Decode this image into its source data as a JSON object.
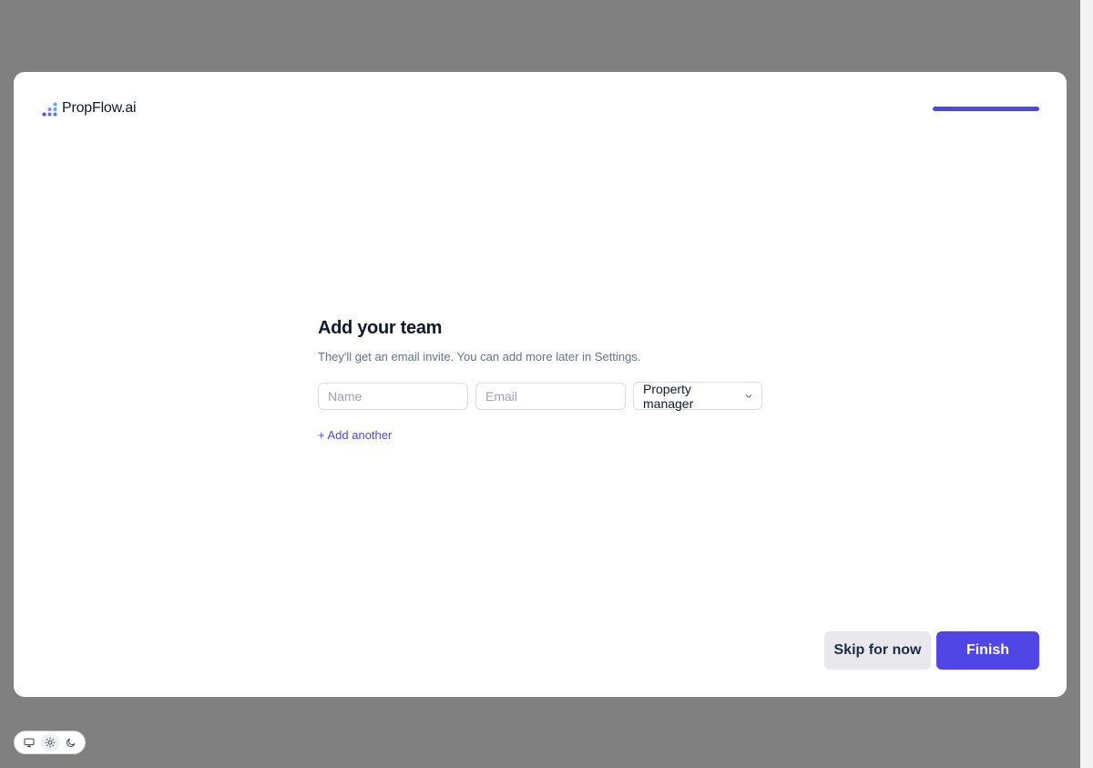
{
  "brand": {
    "name": "PropFlow.ai",
    "accent_color": "#4f46e5"
  },
  "onboarding": {
    "progress_percent": 100
  },
  "team_step": {
    "title": "Add your team",
    "subtitle": "They'll get an email invite. You can add more later in Settings.",
    "name_placeholder": "Name",
    "email_placeholder": "Email",
    "role_selected": "Property manager",
    "add_another_label": "+ Add another"
  },
  "actions": {
    "skip_label": "Skip for now",
    "finish_label": "Finish"
  },
  "theme_toggle": {
    "options": [
      "system-monitor-icon",
      "sun-icon",
      "moon-icon"
    ],
    "selected": "sun-icon"
  }
}
